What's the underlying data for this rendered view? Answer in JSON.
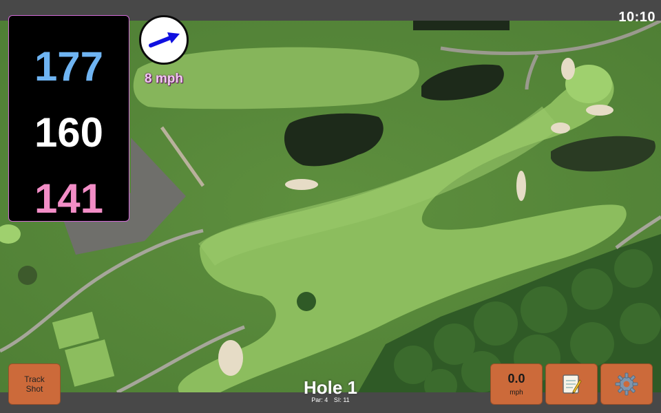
{
  "status": {
    "time": "10:10"
  },
  "distances": {
    "back": "177",
    "middle": "160",
    "front": "141"
  },
  "wind": {
    "speed": "8 mph",
    "arrow_icon": "wind-direction-arrow"
  },
  "buttons": {
    "track_shot_line1": "Track",
    "track_shot_line2": "Shot",
    "speed_value": "0.0",
    "speed_unit": "mph",
    "notes_icon": "notepad-icon",
    "settings_icon": "gear-icon"
  },
  "hole": {
    "title": "Hole 1",
    "par": "Par: 4",
    "si": "SI: 11"
  },
  "colors": {
    "back": "#6fb4f2",
    "middle": "#ffffff",
    "front": "#f28dc6",
    "button": "#cc6a3a",
    "panel_border": "#d26ad8"
  }
}
